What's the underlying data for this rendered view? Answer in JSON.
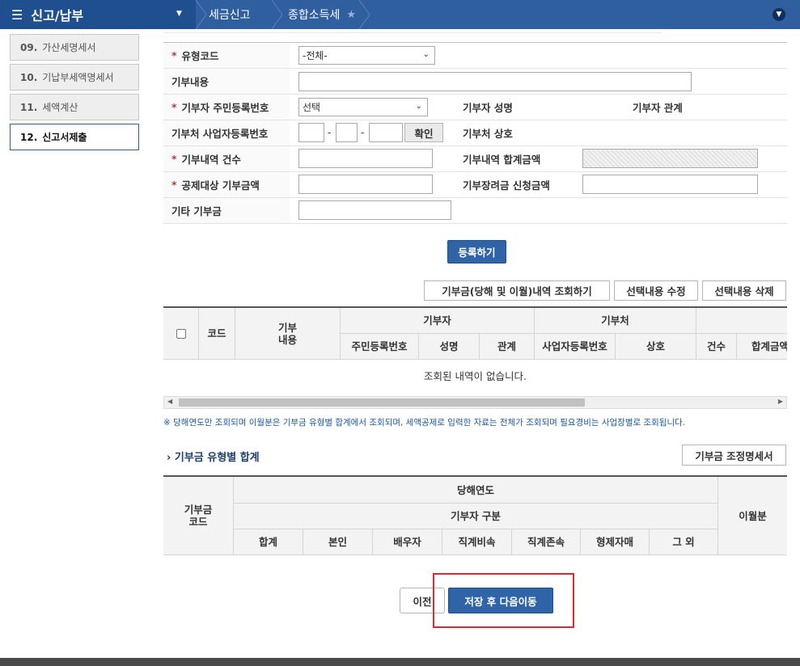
{
  "header": {
    "menu_icon": "menu-icon",
    "title": "신고/납부",
    "breadcrumb": [
      "세금신고",
      "종합소득세"
    ]
  },
  "sidebar": {
    "items": [
      {
        "num": "09.",
        "label": "가산세명세서"
      },
      {
        "num": "10.",
        "label": "기납부세액명세서"
      },
      {
        "num": "11.",
        "label": "세액계산"
      },
      {
        "num": "12.",
        "label": "신고서제출"
      }
    ]
  },
  "form": {
    "type_code_label": "유형코드",
    "type_code_value": "-전체-",
    "content_label": "기부내용",
    "donor_rrn_label": "기부자 주민등록번호",
    "donor_rrn_value": "선택",
    "donor_name_label": "기부자 성명",
    "donor_relation_label": "기부자 관계",
    "org_brn_label": "기부처 사업자등록번호",
    "dash": "-",
    "confirm_label": "확인",
    "org_name_label": "기부처 상호",
    "count_label": "기부내역 건수",
    "total_label": "기부내역 합계금액",
    "deductible_label": "공제대상 기부금액",
    "scholarship_label": "기부장려금 신청금액",
    "other_label": "기타 기부금"
  },
  "actions": {
    "register": "등록하기",
    "query": "기부금(당해 및 이월)내역 조회하기",
    "edit": "선택내용 수정",
    "delete": "선택내용 삭제"
  },
  "grid": {
    "code": "코드",
    "content": "기부\n내용",
    "donor": "기부자",
    "org": "기부처",
    "rrn": "주민등록번호",
    "name": "성명",
    "relation": "관계",
    "brn": "사업자등록번호",
    "trade": "상호",
    "count": "건수",
    "total": "합계금액",
    "empty": "조회된 내역이 없습니다."
  },
  "note": "※ 당해연도만 조회되며 이월분은 기부금 유형별 합계에서 조회되며, 세액공제로 입력한 자료는 전체가 조회되며 필요경비는 사업장별로 조회됩니다.",
  "summary": {
    "title": "› 기부금 유형별 합계",
    "adjust_btn": "기부금 조정명세서",
    "code": "기부금\n코드",
    "current_year": "당해연도",
    "donor_type": "기부자 구분",
    "carryover": "이월분",
    "cols": [
      "합계",
      "본인",
      "배우자",
      "직계비속",
      "직계존속",
      "형제자매",
      "그 외"
    ]
  },
  "nav": {
    "prev": "이전",
    "save_next": "저장 후 다음이동"
  }
}
